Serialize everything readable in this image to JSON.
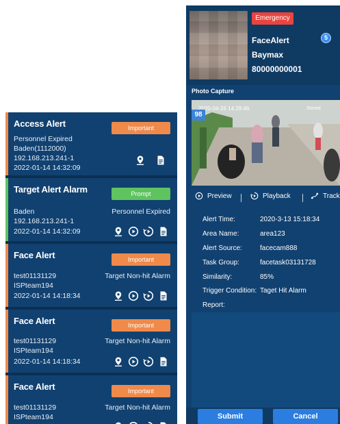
{
  "alerts": [
    {
      "title": "Access Alert",
      "badge": "Important",
      "badge_color": "#f08a4b",
      "stripe_color": "#f08a4b",
      "lines": [
        "Personnel Expired",
        "Baden(1112000)",
        "192.168.213.241-1",
        "2022-01-14 14:32:09"
      ],
      "right_text": "",
      "icons": [
        "location-pin-icon",
        "document-icon"
      ]
    },
    {
      "title": "Target Alert Alarm",
      "badge": "Prompt",
      "badge_color": "#5fc35f",
      "stripe_color": "#5fc35f",
      "lines": [
        "Baden",
        "192.168.213.241-1",
        "2022-01-14 14:32:09"
      ],
      "right_text": "Personnel Expired",
      "icons": [
        "location-pin-icon",
        "play-icon",
        "playback-icon",
        "document-icon"
      ]
    },
    {
      "title": "Face Alert",
      "badge": "Important",
      "badge_color": "#f08a4b",
      "stripe_color": "#f08a4b",
      "lines": [
        "test01131129",
        "ISPteam194",
        "2022-01-14 14:18:34"
      ],
      "right_text": "Target Non-hit Alarm",
      "icons": [
        "location-pin-icon",
        "play-icon",
        "playback-icon",
        "document-icon"
      ]
    },
    {
      "title": "Face Alert",
      "badge": "Important",
      "badge_color": "#f08a4b",
      "stripe_color": "#f08a4b",
      "lines": [
        "test01131129",
        "ISPteam194",
        "2022-01-14 14:18:34"
      ],
      "right_text": "Target Non-hit Alarm",
      "icons": [
        "location-pin-icon",
        "play-icon",
        "playback-icon",
        "document-icon"
      ]
    },
    {
      "title": "Face Alert",
      "badge": "Important",
      "badge_color": "#f08a4b",
      "stripe_color": "#f08a4b",
      "lines": [
        "test01131129",
        "ISPteam194"
      ],
      "right_text": "Target Non-hit Alarm",
      "icons": [
        "location-pin-icon",
        "play-icon",
        "playback-icon",
        "document-icon"
      ]
    }
  ],
  "detail": {
    "level_badge": "Emergency",
    "level_color": "#e9443f",
    "count": "5",
    "alert_name": "FaceAlert",
    "person_name": "Baymax",
    "person_id": "80000000001",
    "capture_label": "Photo Capture",
    "capture_timestamp": "2020-04-26  14:29:46",
    "capture_tag": "98",
    "capture_store": "Stored",
    "actions": [
      {
        "label": "Preview",
        "icon": "play-circle-icon"
      },
      {
        "label": "Playback",
        "icon": "playback-icon"
      },
      {
        "label": "Track",
        "icon": "track-icon"
      }
    ],
    "fields": [
      {
        "label": "Alert Time:",
        "value": "2020-3-13 15:18:34"
      },
      {
        "label": "Area Name:",
        "value": "area123"
      },
      {
        "label": "Alert Source:",
        "value": "facecam888"
      },
      {
        "label": "Task Group:",
        "value": "facetask03131728"
      },
      {
        "label": "Similarity:",
        "value": "85%"
      },
      {
        "label": "Trigger Condition:",
        "value": "Taget Hit Alarm"
      },
      {
        "label": "Report:",
        "value": ""
      }
    ],
    "submit_label": "Submit",
    "cancel_label": "Cancel"
  },
  "colors": {
    "panel": "#114170",
    "panel_dark": "#0f3a62",
    "accent": "#2c7de0"
  }
}
